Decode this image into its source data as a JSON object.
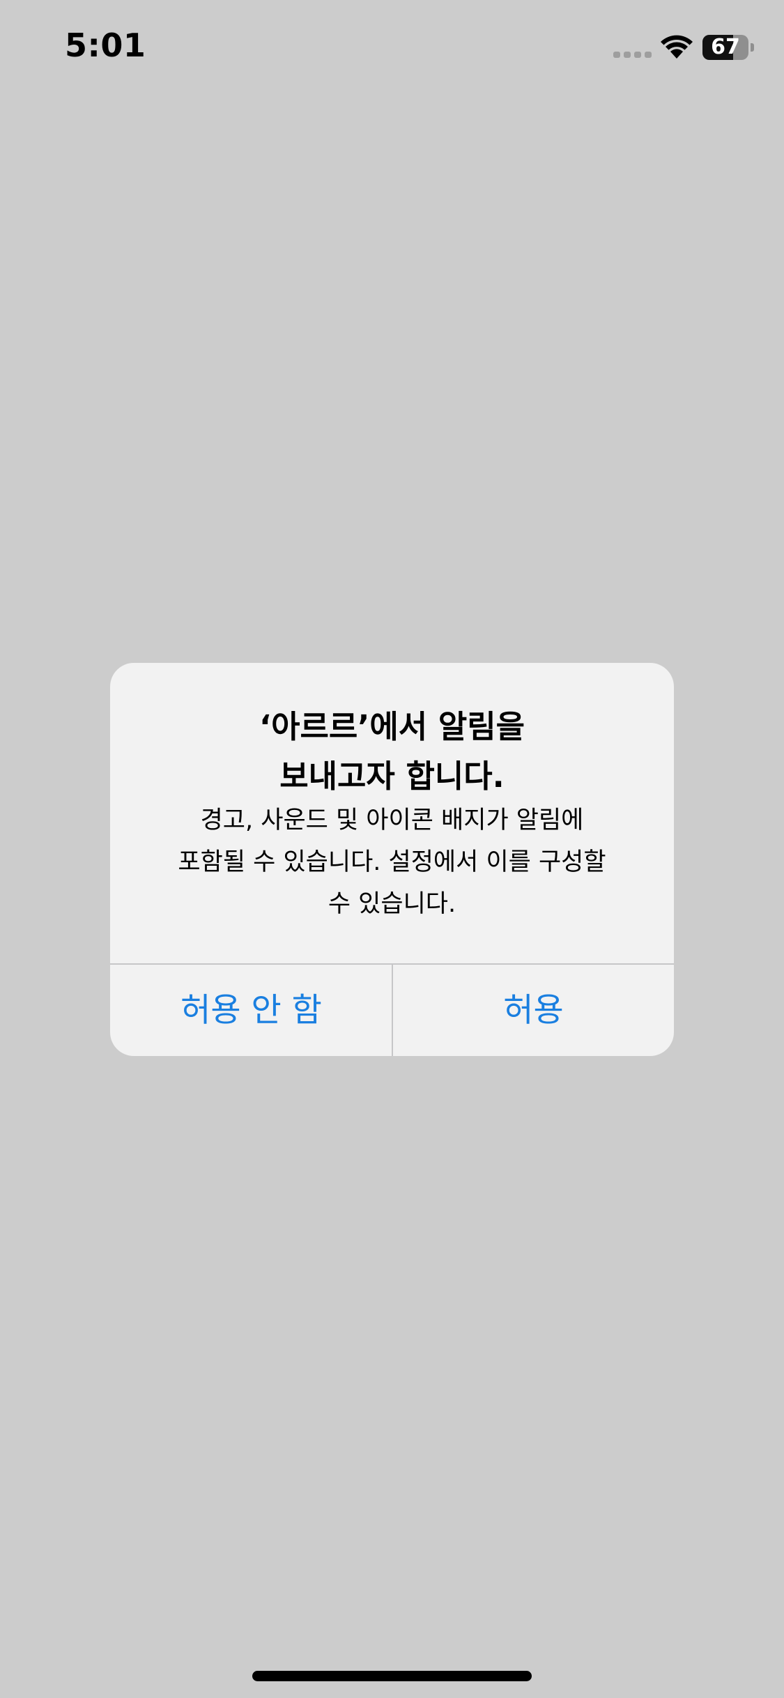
{
  "status_bar": {
    "time": "5:01",
    "battery_level": "67",
    "battery_fraction": 0.67,
    "icons": [
      "signal-icon",
      "wifi-icon",
      "battery-icon"
    ]
  },
  "alert": {
    "title": "‘아르르’에서 알림을\n보내고자 합니다.",
    "message": "경고, 사운드 및 아이콘 배지가 알림에\n포함될 수 있습니다. 설정에서 이를 구성할\n수 있습니다.",
    "deny_label": "허용 안 함",
    "allow_label": "허용"
  },
  "colors": {
    "background": "#cccccc",
    "alert_background": "#f2f2f2",
    "button_text": "#1a7fe0"
  }
}
